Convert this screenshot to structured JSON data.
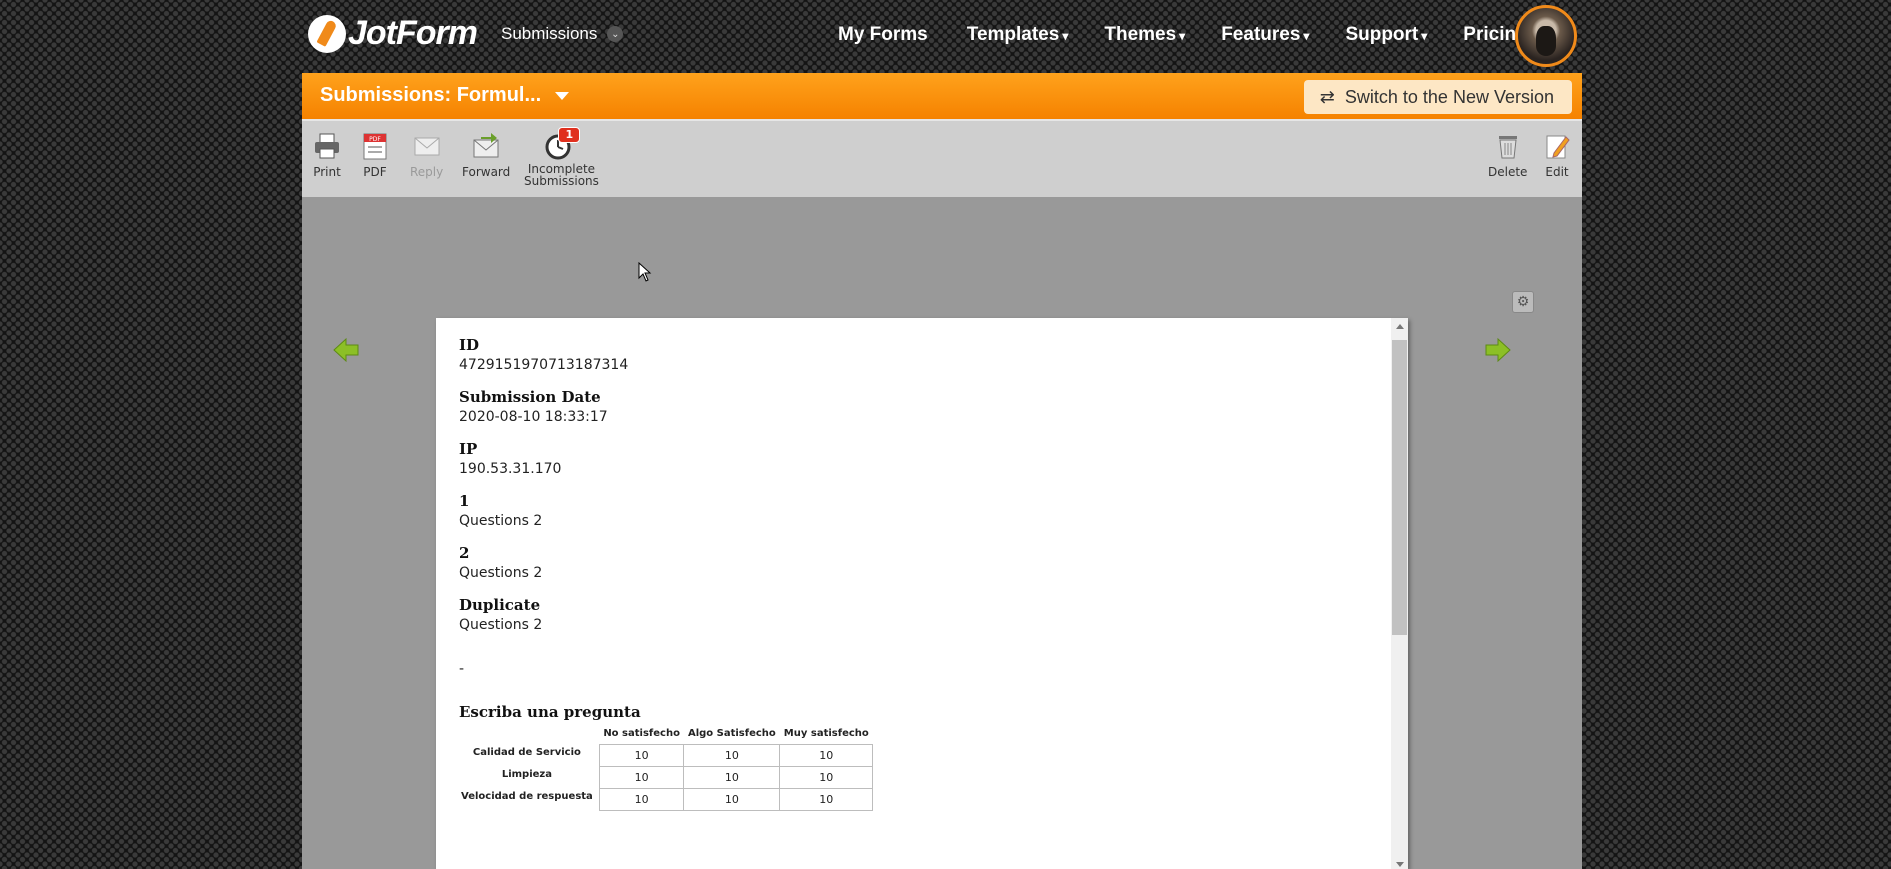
{
  "nav": {
    "logo_text": "JotForm",
    "submissions_label": "Submissions",
    "menu": [
      {
        "label": "My Forms",
        "caret": ""
      },
      {
        "label": "Templates",
        "caret": "▾"
      },
      {
        "label": "Themes",
        "caret": "▾"
      },
      {
        "label": "Features",
        "caret": "▾"
      },
      {
        "label": "Support",
        "caret": "▾"
      },
      {
        "label": "Pricing",
        "caret": ""
      }
    ]
  },
  "header": {
    "title": "Submissions: Formul...",
    "switch_label": "Switch to the New Version"
  },
  "toolbar": {
    "print": "Print",
    "pdf": "PDF",
    "reply": "Reply",
    "forward": "Forward",
    "incomplete_line1": "Incomplete",
    "incomplete_line2": "Submissions",
    "incomplete_badge": "1",
    "delete": "Delete",
    "edit": "Edit"
  },
  "submission": {
    "fields": [
      {
        "label": "ID",
        "value": "4729151970713187314"
      },
      {
        "label": "Submission Date",
        "value": "2020-08-10 18:33:17"
      },
      {
        "label": "IP",
        "value": "190.53.31.170"
      },
      {
        "label": "1",
        "value": "Questions 2"
      },
      {
        "label": "2",
        "value": "Questions 2"
      },
      {
        "label": "Duplicate",
        "value": "Questions 2"
      }
    ],
    "dash": "-",
    "matrix": {
      "label": "Escriba una pregunta",
      "columns": [
        "No satisfecho",
        "Algo Satisfecho",
        "Muy satisfecho"
      ],
      "rows": [
        {
          "name": "Calidad de Servicio",
          "values": [
            "10",
            "10",
            "10"
          ]
        },
        {
          "name": "Limpieza",
          "values": [
            "10",
            "10",
            "10"
          ]
        },
        {
          "name": "Velocidad de respuesta",
          "values": [
            "10",
            "10",
            "10"
          ]
        }
      ]
    }
  },
  "colors": {
    "accent": "#f58200",
    "switch_bg": "#fde7c5",
    "toolbar_bg": "#cfcfcf",
    "arrow_green": "#8cbf26"
  }
}
